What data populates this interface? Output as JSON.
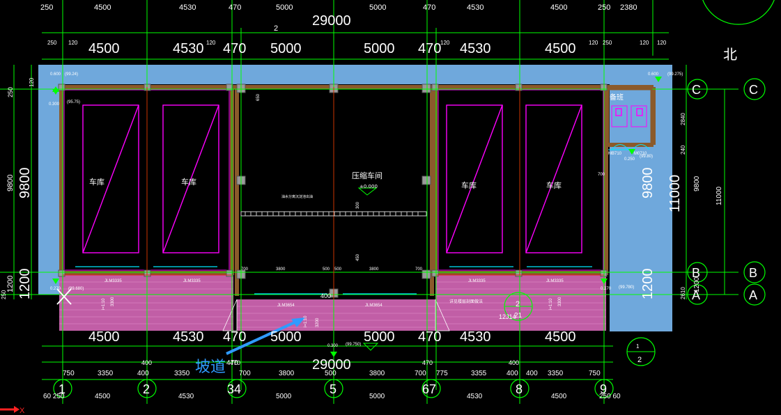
{
  "app": {
    "title": "CAD floor plan",
    "north_label": "北",
    "axis_x_label": "X"
  },
  "colors": {
    "background": "#000000",
    "grid_line": "#00ff00",
    "wall": "#8b5a2b",
    "roof_blue": "#6fa8dc",
    "pink_area": "#e36fc3",
    "magenta": "#ff00ff",
    "red_axis": "#ff0000",
    "annotation_blue": "#2f9bff",
    "white_text": "#ffffff"
  },
  "dims": {
    "top_row": [
      "250",
      "4500",
      "4530",
      "470",
      "5000",
      "5000",
      "470",
      "4530",
      "4500",
      "250",
      "2380"
    ],
    "top_total": "29000",
    "top_total_tag": "2",
    "small_top": [
      "250",
      "120",
      "120",
      "120",
      "120",
      "250",
      "120",
      "120"
    ],
    "big_top": [
      "4500",
      "4530",
      "470",
      "5000",
      "5000",
      "470",
      "4530",
      "4500"
    ],
    "bottom_big": [
      "4500",
      "4530",
      "470",
      "5000",
      "5000",
      "470",
      "4530",
      "4500"
    ],
    "bottom_total": "29000",
    "bottom_fine": [
      "750",
      "3350",
      "400",
      "3350",
      "470",
      "700",
      "3800",
      "500",
      "3800",
      "700",
      "775",
      "3355",
      "400",
      "400",
      "3350",
      "750"
    ],
    "bottom_axis_dims": [
      "60 250",
      "4500",
      "4530",
      "5000",
      "5000",
      "4530",
      "4500",
      "250 60"
    ],
    "bottom_small_vals": [
      "400",
      "400",
      "470",
      "470",
      "400"
    ],
    "left_dims": [
      "250",
      "120",
      "9800",
      "9800",
      "1200",
      "1200",
      "250"
    ],
    "right_dims": [
      "2840",
      "240",
      "9800",
      "11000",
      "9800",
      "11000",
      "1200",
      "1200",
      "2610"
    ]
  },
  "axes_cols": [
    "1",
    "2",
    "34",
    "5",
    "67",
    "8",
    "9"
  ],
  "axes_rows": [
    "C",
    "B",
    "A"
  ],
  "labels": {
    "garage": "车库",
    "compress": "压缩车间",
    "compress_elev": "±0.000",
    "small_room": "备班",
    "ramp": "坡道",
    "drain_note": "油水分离沉淀池出油",
    "elev1": "0.600",
    "elev1b": "(99.24)",
    "elev2": "0.300",
    "elev2b": "(95.75)",
    "elev3": "0.300",
    "elev3b": "(99.750)",
    "elev4": "0.600",
    "elev4b": "(99.275)",
    "elev5": "0.250",
    "elev5b": "(99.80)",
    "elev6": "0.270",
    "elev6b": "(99.680)",
    "elev7": "0.270",
    "elev7b": "(99.780)",
    "door_a": "JLM3335",
    "door_b": "JLM3654",
    "slope_a": "i=1:10",
    "slope_b": "3300",
    "slope_c": "3200",
    "circ_tag": "2",
    "circ_ref": "12J14",
    "circ_num": "21",
    "detail_tag_top": "1",
    "detail_tag_bot": "2",
    "floor_note": "详见楼层剖面做法",
    "dims_inner": [
      "3800",
      "500",
      "500",
      "3800",
      "700",
      "700",
      "700",
      "450",
      "650",
      "300"
    ],
    "room_tag": "MB710",
    "room_tag2": "M0710"
  }
}
